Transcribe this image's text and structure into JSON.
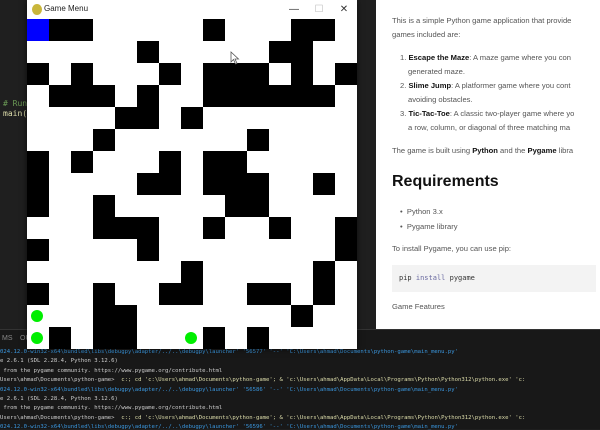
{
  "editor": {
    "code_lines": [
      "# Run",
      "main("
    ]
  },
  "preview": {
    "intro": [
      "This is a simple Python game application that provide",
      "games included are:"
    ],
    "games": [
      {
        "num": "1.",
        "name": "Escape the Maze",
        "desc": ": A maze game where you con",
        "cont": "generated maze."
      },
      {
        "num": "2.",
        "name": "Slime Jump",
        "desc": ": A platformer game where you cont",
        "cont": "avoiding obstacles."
      },
      {
        "num": "3.",
        "name": "Tic-Tac-Toe",
        "desc": ": A classic two-player game where yo",
        "cont": "a row, column, or diagonal of three matching ma"
      }
    ],
    "built": {
      "pre": "The game is built using ",
      "b1": "Python",
      "mid": " and the ",
      "b2": "Pygame",
      "post": " libra"
    },
    "requirements_heading": "Requirements",
    "requirements": [
      "Python 3.x",
      "Pygame library"
    ],
    "install_text": "To install Pygame, you can use pip:",
    "code": {
      "cmd": "pip",
      "kw": "install",
      "arg": "pygame"
    },
    "next_heading": "Game Features"
  },
  "panel": {
    "tabs": [
      "MS",
      "OU"
    ],
    "lines": [
      {
        "blue": true,
        "text": "024.12.0-win32-x64\\bundled\\libs\\debugpy\\adapter/../..\\debugpy\\launcher' '56577' '--' 'C:\\Users\\ahmad\\Documents\\python-game\\main_menu.py'"
      },
      {
        "blue": false,
        "text": "e 2.6.1 (SDL 2.28.4, Python 3.12.6)"
      },
      {
        "blue": false,
        "text": " from the pygame community. https://www.pygame.org/contribute.html"
      },
      {
        "blue": false,
        "prompt": "Users\\ahmad\\Documents\\python-game> ",
        "cmd": " c:; cd 'c:\\Users\\ahmad\\Documents\\python-game'; & 'c:\\Users\\ahmad\\AppData\\Local\\Programs\\Python\\Python312\\python.exe' 'c:"
      },
      {
        "blue": true,
        "text": "024.12.0-win32-x64\\bundled\\libs\\debugpy\\adapter/../..\\debugpy\\launcher' '56586' '--' 'C:\\Users\\ahmad\\Documents\\python-game\\main_menu.py'"
      },
      {
        "blue": false,
        "text": "e 2.6.1 (SDL 2.28.4, Python 3.12.6)"
      },
      {
        "blue": false,
        "text": " from the pygame community. https://www.pygame.org/contribute.html"
      },
      {
        "blue": false,
        "prompt": "Users\\ahmad\\Documents\\python-game> ",
        "cmd": " c:; cd 'c:\\Users\\ahmad\\Documents\\python-game'; & 'c:\\Users\\ahmad\\AppData\\Local\\Programs\\Python\\Python312\\python.exe' 'c:"
      },
      {
        "blue": true,
        "text": "024.12.0-win32-x64\\bundled\\libs\\debugpy\\adapter/../..\\debugpy\\launcher' '56596' '--' 'C:\\Users\\ahmad\\Documents\\python-game\\main_menu.py'"
      }
    ]
  },
  "game_window": {
    "title": "Game Menu",
    "controls": {
      "minimize": "—",
      "maximize": "☐",
      "close": "✕"
    },
    "maze_legend": {
      "1": "wall",
      "0": "path",
      "P": "player",
      "G": "goal"
    },
    "maze": [
      "P11000001000110",
      "000001000001100",
      "101000101110101",
      "011101001111110",
      "000011010000000",
      "000100000010000",
      "101000101100000",
      "100001101110010",
      "100100000110000",
      "000111001001001",
      "100001000000001",
      "000000010000010",
      "100100110011010",
      "G00110000000100",
      "G101100G1010000"
    ],
    "colors": {
      "wall": "#000000",
      "path": "#ffffff",
      "player": "#0000ff",
      "goal": "#00ee00"
    }
  }
}
